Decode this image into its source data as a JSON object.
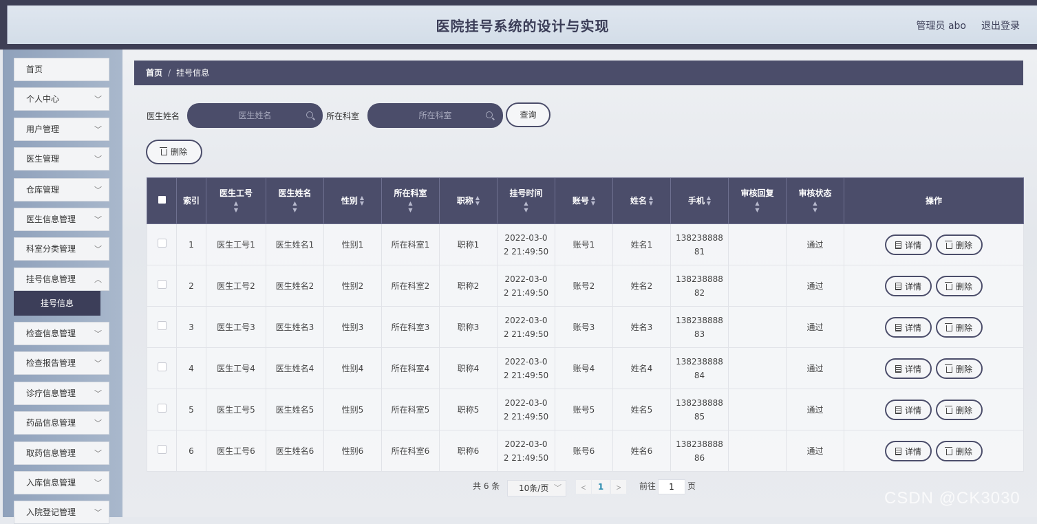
{
  "header": {
    "title": "医院挂号系统的设计与实现",
    "user": "管理员 abo",
    "logout": "退出登录"
  },
  "sidebar": {
    "items": [
      {
        "label": "首页",
        "expandable": false
      },
      {
        "label": "个人中心",
        "expandable": true
      },
      {
        "label": "用户管理",
        "expandable": true
      },
      {
        "label": "医生管理",
        "expandable": true
      },
      {
        "label": "仓库管理",
        "expandable": true
      },
      {
        "label": "医生信息管理",
        "expandable": true
      },
      {
        "label": "科室分类管理",
        "expandable": true
      },
      {
        "label": "挂号信息管理",
        "expandable": true
      },
      {
        "label": "检查信息管理",
        "expandable": true
      },
      {
        "label": "检查报告管理",
        "expandable": true
      },
      {
        "label": "诊疗信息管理",
        "expandable": true
      },
      {
        "label": "药品信息管理",
        "expandable": true
      },
      {
        "label": "取药信息管理",
        "expandable": true
      },
      {
        "label": "入库信息管理",
        "expandable": true
      },
      {
        "label": "入院登记管理",
        "expandable": true
      }
    ],
    "active_sub": "挂号信息"
  },
  "breadcrumb": {
    "home": "首页",
    "separator": "/",
    "current": "挂号信息"
  },
  "search": {
    "doctor_label": "医生姓名",
    "doctor_placeholder": "医生姓名",
    "dept_label": "所在科室",
    "dept_placeholder": "所在科室",
    "query_button": "查询"
  },
  "toolbar": {
    "delete_label": "删除"
  },
  "table": {
    "columns": [
      "索引",
      "医生工号",
      "医生姓名",
      "性别",
      "所在科室",
      "职称",
      "挂号时间",
      "账号",
      "姓名",
      "手机",
      "审核回复",
      "审核状态",
      "操作"
    ],
    "rows": [
      {
        "index": "1",
        "doc_no": "医生工号1",
        "doc_name": "医生姓名1",
        "gender": "性别1",
        "dept": "所在科室1",
        "title": "职称1",
        "time_a": "2022-03-0",
        "time_b": "2 21:49:50",
        "account": "账号1",
        "name": "姓名1",
        "phone_a": "138238888",
        "phone_b": "81",
        "reply": "",
        "status": "通过"
      },
      {
        "index": "2",
        "doc_no": "医生工号2",
        "doc_name": "医生姓名2",
        "gender": "性别2",
        "dept": "所在科室2",
        "title": "职称2",
        "time_a": "2022-03-0",
        "time_b": "2 21:49:50",
        "account": "账号2",
        "name": "姓名2",
        "phone_a": "138238888",
        "phone_b": "82",
        "reply": "",
        "status": "通过"
      },
      {
        "index": "3",
        "doc_no": "医生工号3",
        "doc_name": "医生姓名3",
        "gender": "性别3",
        "dept": "所在科室3",
        "title": "职称3",
        "time_a": "2022-03-0",
        "time_b": "2 21:49:50",
        "account": "账号3",
        "name": "姓名3",
        "phone_a": "138238888",
        "phone_b": "83",
        "reply": "",
        "status": "通过"
      },
      {
        "index": "4",
        "doc_no": "医生工号4",
        "doc_name": "医生姓名4",
        "gender": "性别4",
        "dept": "所在科室4",
        "title": "职称4",
        "time_a": "2022-03-0",
        "time_b": "2 21:49:50",
        "account": "账号4",
        "name": "姓名4",
        "phone_a": "138238888",
        "phone_b": "84",
        "reply": "",
        "status": "通过"
      },
      {
        "index": "5",
        "doc_no": "医生工号5",
        "doc_name": "医生姓名5",
        "gender": "性别5",
        "dept": "所在科室5",
        "title": "职称5",
        "time_a": "2022-03-0",
        "time_b": "2 21:49:50",
        "account": "账号5",
        "name": "姓名5",
        "phone_a": "138238888",
        "phone_b": "85",
        "reply": "",
        "status": "通过"
      },
      {
        "index": "6",
        "doc_no": "医生工号6",
        "doc_name": "医生姓名6",
        "gender": "性别6",
        "dept": "所在科室6",
        "title": "职称6",
        "time_a": "2022-03-0",
        "time_b": "2 21:49:50",
        "account": "账号6",
        "name": "姓名6",
        "phone_a": "138238888",
        "phone_b": "86",
        "reply": "",
        "status": "通过"
      }
    ],
    "detail_label": "详情",
    "delete_label": "删除"
  },
  "pagination": {
    "total": "共 6 条",
    "page_size": "10条/页",
    "prev": "<",
    "current_page": "1",
    "next": ">",
    "goto_label": "前往",
    "goto_value": "1",
    "page_suffix": "页"
  },
  "watermark": "CSDN @CK3030",
  "colors": {
    "primary": "#4b4d6a",
    "sidebar": "#9aabc3",
    "accent_page": "#2a8cb0"
  }
}
